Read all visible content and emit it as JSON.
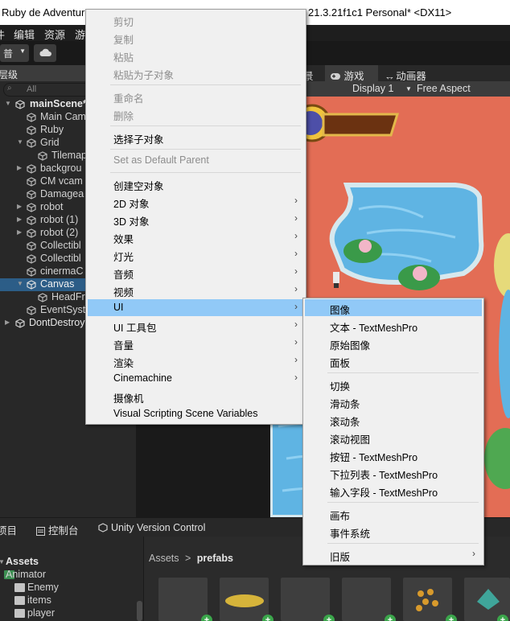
{
  "titlebar": {
    "title_left": "Ruby de Adventure",
    "title_right": "21.3.21f1c1 Personal* <DX11>"
  },
  "menubar": {
    "items": [
      "件",
      "编辑",
      "资源",
      "游"
    ]
  },
  "toolbar": {
    "dropdown_label": "普"
  },
  "hierarchy": {
    "tab_label": "层级",
    "search_placeholder": "All",
    "rows": [
      {
        "label": "mainScene*"
      },
      {
        "label": "Main Cam"
      },
      {
        "label": "Ruby"
      },
      {
        "label": "Grid"
      },
      {
        "label": "Tilemap"
      },
      {
        "label": "backgrou"
      },
      {
        "label": "CM vcam"
      },
      {
        "label": "Damagea"
      },
      {
        "label": "robot"
      },
      {
        "label": "robot (1)"
      },
      {
        "label": "robot (2)"
      },
      {
        "label": "Collectibl"
      },
      {
        "label": "Collectibl"
      },
      {
        "label": "cinermaC"
      },
      {
        "label": "Canvas"
      },
      {
        "label": "HeadFr"
      },
      {
        "label": "EventSyst"
      },
      {
        "label": "DontDestroy"
      }
    ]
  },
  "views": {
    "scene_tab_fragment": "景",
    "game_tab": "游戏",
    "animator_tab": "动画器",
    "display": "Display 1",
    "aspect": "Free Aspect"
  },
  "context_menu": {
    "items": [
      {
        "label": "剪切",
        "disabled": true
      },
      {
        "label": "复制",
        "disabled": true
      },
      {
        "label": "粘贴",
        "disabled": true
      },
      {
        "label": "粘贴为子对象",
        "disabled": true
      },
      {
        "label": "重命名",
        "disabled": true
      },
      {
        "label": "删除",
        "disabled": true
      },
      {
        "label": "选择子对象",
        "disabled": false
      },
      {
        "label": "Set as Default Parent",
        "disabled": true
      },
      {
        "label": "创建空对象",
        "disabled": false
      },
      {
        "label": "2D 对象",
        "submenu": true
      },
      {
        "label": "3D 对象",
        "submenu": true
      },
      {
        "label": "效果",
        "submenu": true
      },
      {
        "label": "灯光",
        "submenu": true
      },
      {
        "label": "音频",
        "submenu": true
      },
      {
        "label": "视频",
        "submenu": true
      },
      {
        "label": "UI",
        "submenu": true,
        "highlighted": true
      },
      {
        "label": "UI 工具包",
        "submenu": true
      },
      {
        "label": "音量",
        "submenu": true
      },
      {
        "label": "渲染",
        "submenu": true
      },
      {
        "label": "Cinemachine",
        "submenu": true
      },
      {
        "label": "摄像机",
        "submenu": false
      },
      {
        "label": "Visual Scripting Scene Variables",
        "submenu": false
      }
    ],
    "submenu_arrow": "›"
  },
  "ui_submenu": {
    "items": [
      {
        "label": "图像",
        "highlighted": true
      },
      {
        "label": "文本 - TextMeshPro"
      },
      {
        "label": "原始图像"
      },
      {
        "label": "面板"
      },
      {
        "label": "切换"
      },
      {
        "label": "滑动条"
      },
      {
        "label": "滚动条"
      },
      {
        "label": "滚动视图"
      },
      {
        "label": "按钮 - TextMeshPro"
      },
      {
        "label": "下拉列表 - TextMeshPro"
      },
      {
        "label": "输入字段 - TextMeshPro"
      },
      {
        "label": "画布"
      },
      {
        "label": "事件系统"
      },
      {
        "label": "旧版",
        "submenu": true
      }
    ]
  },
  "bottom": {
    "tabs": [
      "项目",
      "控制台",
      "Unity Version Control"
    ],
    "breadcrumb_root": "Assets",
    "breadcrumb_sep": ">",
    "breadcrumb_current": "prefabs",
    "tree": [
      "Assets",
      "Animator",
      "Enemy",
      "items",
      "player"
    ]
  },
  "colors": {
    "selection": "#2c5d87",
    "menu_highlight": "#91c9f7",
    "game_background": "#e36d55",
    "water": "#5fb4e3"
  }
}
